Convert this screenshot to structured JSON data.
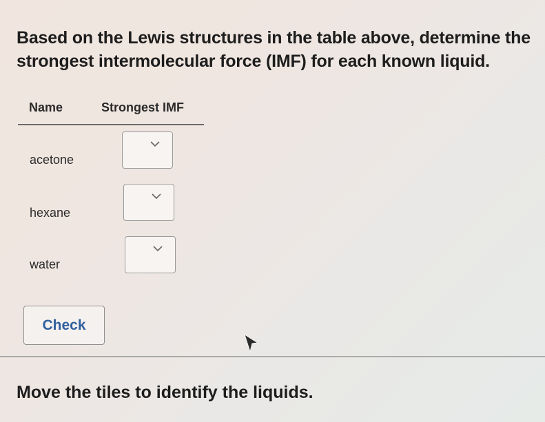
{
  "question": {
    "prompt": "Based on the Lewis structures in the table above, determine the strongest intermolecular force (IMF) for each known liquid."
  },
  "table": {
    "headers": {
      "name": "Name",
      "imf": "Strongest IMF"
    },
    "rows": [
      {
        "name": "acetone",
        "selected_value": ""
      },
      {
        "name": "hexane",
        "selected_value": ""
      },
      {
        "name": "water",
        "selected_value": ""
      }
    ]
  },
  "actions": {
    "check_label": "Check"
  },
  "tiles_section": {
    "instruction": "Move the tiles to identify the liquids."
  },
  "icons": {
    "dropdown": "chevron-down-icon",
    "pointer": "mouse-cursor-icon"
  },
  "colors": {
    "check_text": "#2f5f9e",
    "text": "#1d1d1d"
  }
}
